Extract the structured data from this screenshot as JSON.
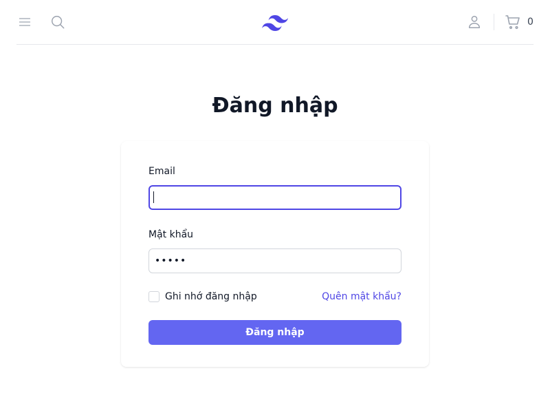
{
  "header": {
    "menu_icon": "menu-icon",
    "search_icon": "search-icon",
    "logo_icon": "logo-icon",
    "user_icon": "user-icon",
    "cart_icon": "cart-icon",
    "cart_count": "0"
  },
  "colors": {
    "accent": "#4f46e5",
    "button": "#6366f1",
    "icon": "#9ca3af"
  },
  "page": {
    "title": "Đăng nhập"
  },
  "form": {
    "email_label": "Email",
    "email_value": "",
    "password_label": "Mật khẩu",
    "password_value": "•••••",
    "remember_label": "Ghi nhớ đăng nhập",
    "remember_checked": false,
    "forgot_label": "Quên mật khẩu?",
    "submit_label": "Đăng nhập"
  }
}
